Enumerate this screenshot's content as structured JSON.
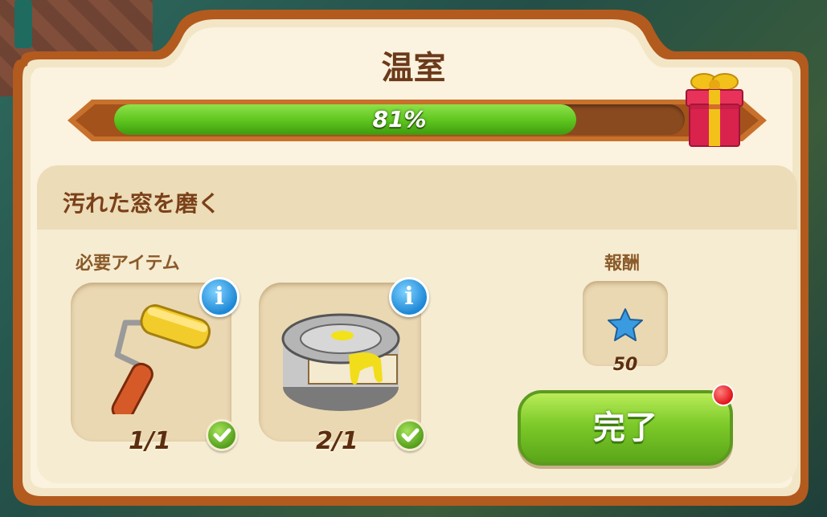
{
  "window": {
    "title": "温室"
  },
  "progress": {
    "label": "81%",
    "value": 0.81
  },
  "task": {
    "title": "汚れた窓を磨く"
  },
  "required": {
    "label": "必要アイテム",
    "items": [
      {
        "icon": "paint-roller-icon",
        "count": "1/1",
        "complete": true
      },
      {
        "icon": "paint-can-icon",
        "count": "2/1",
        "complete": true
      }
    ]
  },
  "reward": {
    "label": "報酬",
    "icon": "blue-star-icon",
    "amount": "50"
  },
  "actions": {
    "complete_label": "完了"
  },
  "colors": {
    "accent_green": "#5cc41c",
    "frame_brown": "#b35a1e",
    "panel_cream": "#f6ecd2",
    "info_blue": "#1e88d6",
    "notification_red": "#e2141a"
  }
}
